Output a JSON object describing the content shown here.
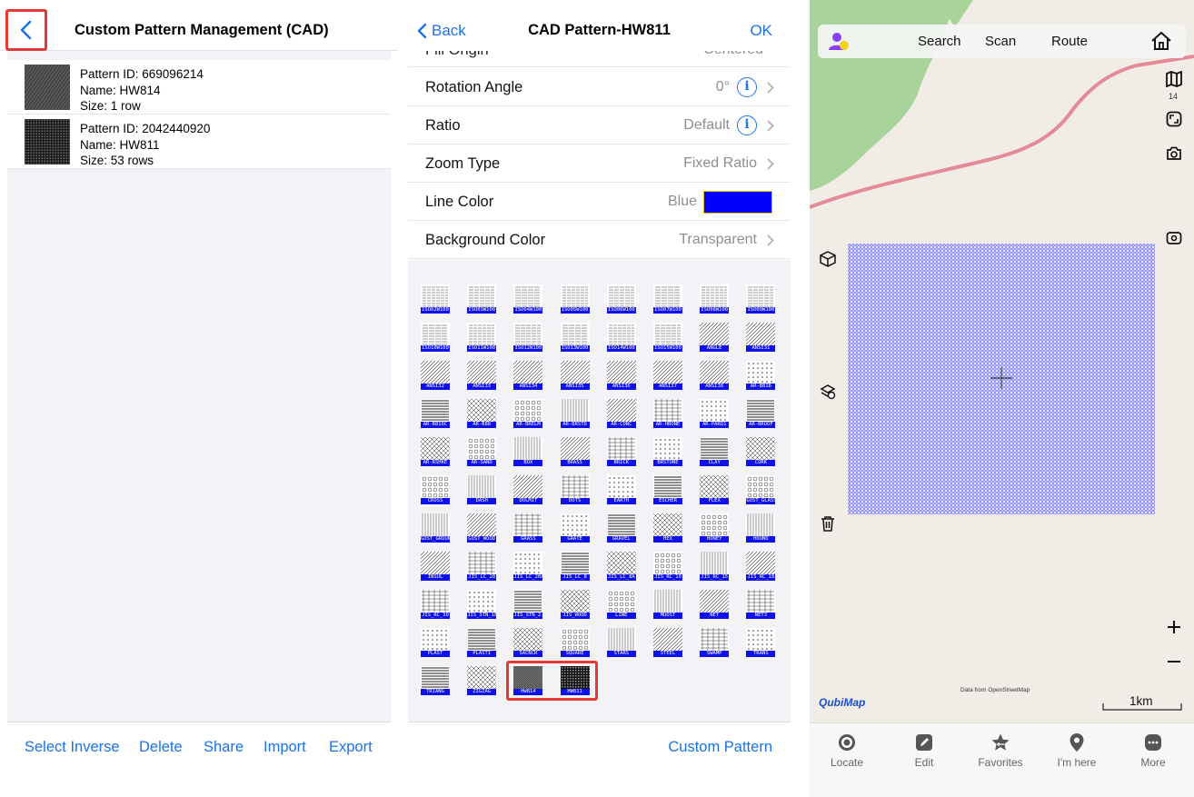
{
  "left": {
    "title": "Custom Pattern Management (CAD)",
    "patterns": [
      {
        "id_line": "Pattern ID: 669096214",
        "name_line": "Name: HW814",
        "size_line": "Size: 1 row"
      },
      {
        "id_line": "Pattern ID: 2042440920",
        "name_line": "Name: HW811",
        "size_line": "Size: 53 rows"
      }
    ],
    "toolbar": {
      "select_inverse": "Select Inverse",
      "delete": "Delete",
      "share": "Share",
      "import": "Import",
      "export": "Export"
    }
  },
  "middle": {
    "back_label": "Back",
    "title": "CAD Pattern-HW811",
    "ok_label": "OK",
    "partial_row": {
      "label": "Fill Origin",
      "value": "Centered"
    },
    "rows": [
      {
        "label": "Rotation Angle",
        "value": "0°",
        "info": true
      },
      {
        "label": "Ratio",
        "value": "Default",
        "info": true
      },
      {
        "label": "Zoom Type",
        "value": "Fixed Ratio",
        "info": false
      },
      {
        "label": "Line Color",
        "value": "Blue",
        "swatch": "#0000ff"
      },
      {
        "label": "Background Color",
        "value": "Transparent",
        "info": false
      }
    ],
    "patterns": [
      "ISO02W100",
      "ISO03W100",
      "ISO04W100",
      "ISO05W100",
      "ISO06W100",
      "ISO07W100",
      "ISO08W100",
      "ISO09W100",
      "ISO10W100",
      "ISO11W100",
      "ISO12W100",
      "ISO13W100",
      "ISO14W100",
      "ISO15W100",
      "ANGLE",
      "ANSI31",
      "ANSI32",
      "ANSI33",
      "ANSI34",
      "ANSI35",
      "ANSI36",
      "ANSI37",
      "ANSI38",
      "AR-B816",
      "AR-B816C",
      "AR-B88",
      "AR-BRELM",
      "AR-BRSTD",
      "AR-CONC",
      "AR-HBONE",
      "AR-PARQ1",
      "AR-RROOF",
      "AR-RSHKE",
      "AR-SAND",
      "BOX",
      "BRASS",
      "BRICK",
      "BRSTONE",
      "CLAY",
      "CORK",
      "CROSS",
      "DASH",
      "DOLMIT",
      "DOTS",
      "EARTH",
      "ESCHER",
      "FLEX",
      "GOST_GLASS",
      "GOST_GROUND",
      "GOST_WOOD",
      "GRASS",
      "GRATE",
      "GRAVEL",
      "HEX",
      "HONEY",
      "HOUND",
      "INSUL",
      "JIS_LC_20",
      "JIS_LC_20A",
      "JIS_LC_8",
      "JIS_LC_8A",
      "JIS_RC_10",
      "JIS_RC_15",
      "JIS_RC_18",
      "JIS_RC_30",
      "JIS_STN_1E",
      "JIS_STN_2.5",
      "JIS_WOOD",
      "LINE",
      "MUDST",
      "NET",
      "NET3",
      "PLAST",
      "PLASTI",
      "SACNCR",
      "SQUARE",
      "STARS",
      "STEEL",
      "SWAMP",
      "TRANS",
      "TRIANG",
      "ZIGZAG",
      "HW814",
      "HW811"
    ],
    "custom_pattern_label": "Custom Pattern"
  },
  "map": {
    "search": "Search",
    "scan": "Scan",
    "route": "Route",
    "zoom_level": "14",
    "brand": "QubiMap",
    "attribution": "Data from OpenStreetMap",
    "scale": "1km",
    "tabs": [
      "Locate",
      "Edit",
      "Favorites",
      "I'm here",
      "More"
    ],
    "pattern_color": "#5a5af0",
    "road_color": "#e58a97",
    "park_color": "#a8d49c"
  }
}
